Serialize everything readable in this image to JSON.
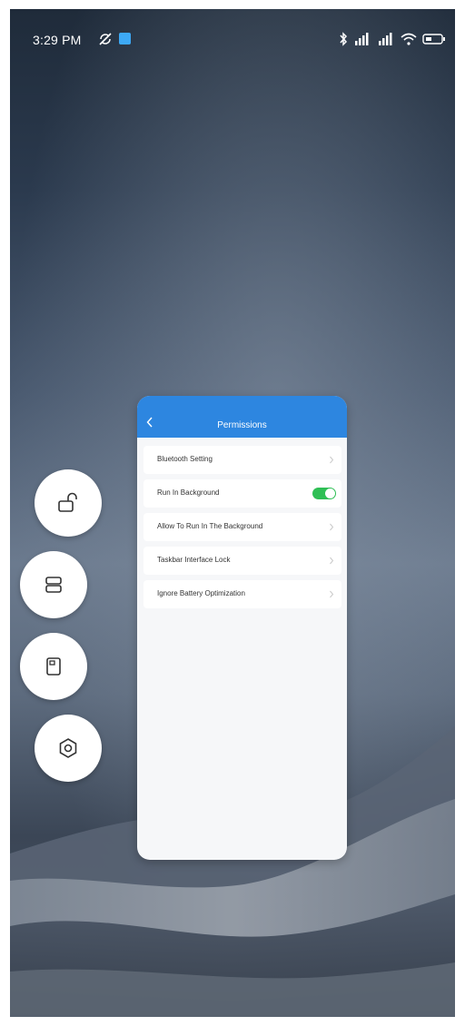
{
  "status_bar": {
    "time": "3:29 PM",
    "icons": [
      "sync-off-icon",
      "app-notification-icon",
      "bluetooth-icon",
      "signal-1-icon",
      "signal-2-icon",
      "wifi-icon",
      "battery-icon"
    ]
  },
  "floating_buttons": [
    {
      "name": "lock-button",
      "icon": "unlock-icon"
    },
    {
      "name": "layout-button",
      "icon": "layout-icon"
    },
    {
      "name": "window-button",
      "icon": "window-icon"
    },
    {
      "name": "settings-button",
      "icon": "settings-icon"
    }
  ],
  "permissions": {
    "title": "Permissions",
    "items": [
      {
        "label": "Bluetooth Setting",
        "control": "chevron"
      },
      {
        "label": "Run In Background",
        "control": "toggle",
        "enabled": true
      },
      {
        "label": "Allow To Run In The Background",
        "control": "chevron"
      },
      {
        "label": "Taskbar Interface Lock",
        "control": "chevron"
      },
      {
        "label": "Ignore Battery Optimization",
        "control": "chevron"
      }
    ]
  },
  "colors": {
    "header_blue": "#2d86e0",
    "toggle_green": "#2fbf55"
  }
}
